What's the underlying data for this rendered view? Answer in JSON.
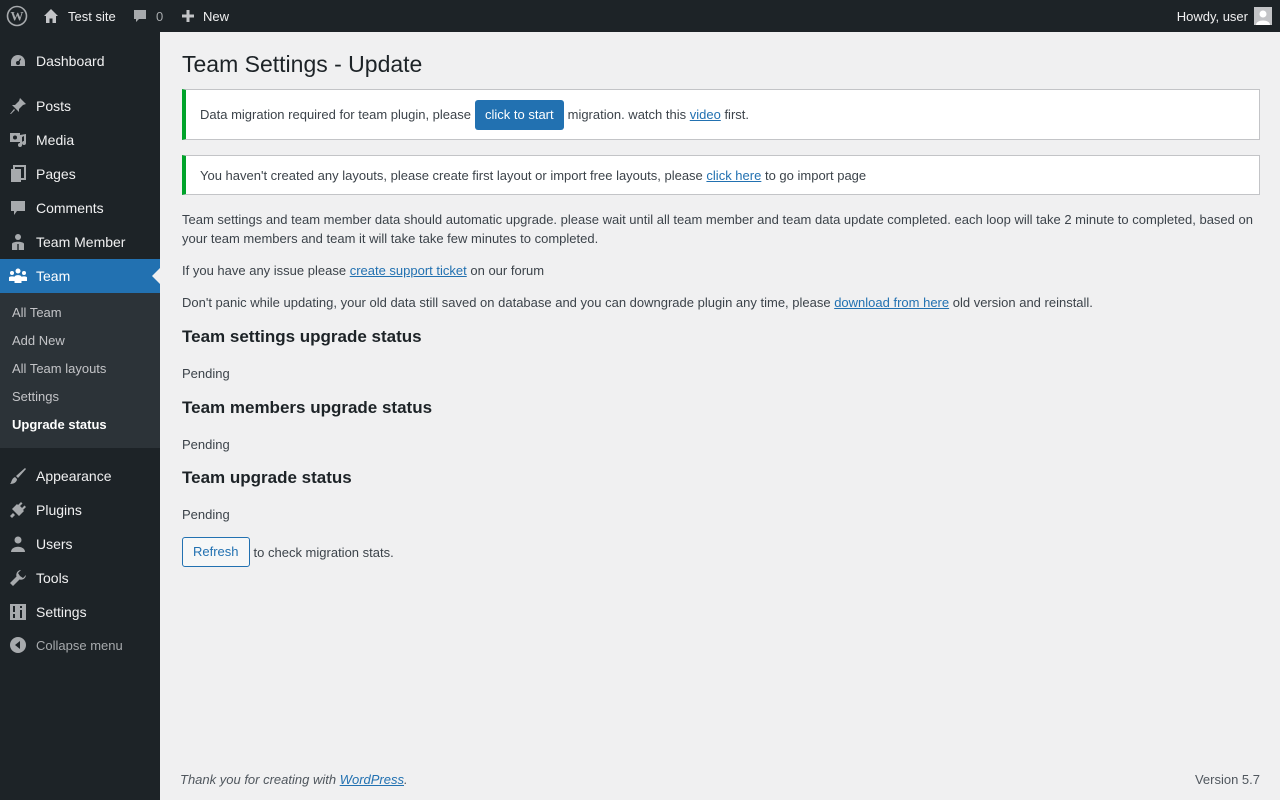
{
  "adminbar": {
    "site_name": "Test site",
    "comments_count": "0",
    "new_label": "New",
    "howdy": "Howdy, user"
  },
  "sidebar": {
    "items": [
      {
        "label": "Dashboard",
        "icon": "dashboard-icon"
      },
      {
        "label": "Posts",
        "icon": "pin-icon"
      },
      {
        "label": "Media",
        "icon": "media-icon"
      },
      {
        "label": "Pages",
        "icon": "pages-icon"
      },
      {
        "label": "Comments",
        "icon": "comment-icon"
      },
      {
        "label": "Team Member",
        "icon": "person-icon"
      },
      {
        "label": "Team",
        "icon": "groups-icon"
      },
      {
        "label": "Appearance",
        "icon": "brush-icon"
      },
      {
        "label": "Plugins",
        "icon": "plug-icon"
      },
      {
        "label": "Users",
        "icon": "user-icon"
      },
      {
        "label": "Tools",
        "icon": "wrench-icon"
      },
      {
        "label": "Settings",
        "icon": "settings-icon"
      }
    ],
    "submenu": [
      "All Team",
      "Add New",
      "All Team layouts",
      "Settings",
      "Upgrade status"
    ],
    "collapse_label": "Collapse menu"
  },
  "page": {
    "title": "Team Settings - Update",
    "notice1": {
      "before": "Data migration required for team plugin, please",
      "button": "click to start",
      "middle": "migration. watch this",
      "link": "video",
      "after": "first."
    },
    "notice2": {
      "before": "You haven't created any layouts, please create first layout or import free layouts, please",
      "link": "click here",
      "after": "to go import page"
    },
    "para1": "Team settings and team member data should automatic upgrade. please wait until all team member and team data update completed. each loop will take 2 minute to completed, based on your team members and team it will take take few minutes to completed.",
    "para2": {
      "before": "If you have any issue please",
      "link": "create support ticket",
      "after": "on our forum"
    },
    "para3": {
      "before": "Don't panic while updating, your old data still saved on database and you can downgrade plugin any time, please",
      "link": "download from here",
      "after": "old version and reinstall."
    },
    "sections": [
      {
        "heading": "Team settings upgrade status",
        "status": "Pending"
      },
      {
        "heading": "Team members upgrade status",
        "status": "Pending"
      },
      {
        "heading": "Team upgrade status",
        "status": "Pending"
      }
    ],
    "refresh_button": "Refresh",
    "refresh_text": "to check migration stats."
  },
  "footer": {
    "thank_you": "Thank you for creating with",
    "wp_link": "WordPress",
    "version": "Version 5.7"
  },
  "colors": {
    "accent": "#2271b1",
    "notice_border": "#00a32a",
    "adminbar_bg": "#1d2327"
  }
}
